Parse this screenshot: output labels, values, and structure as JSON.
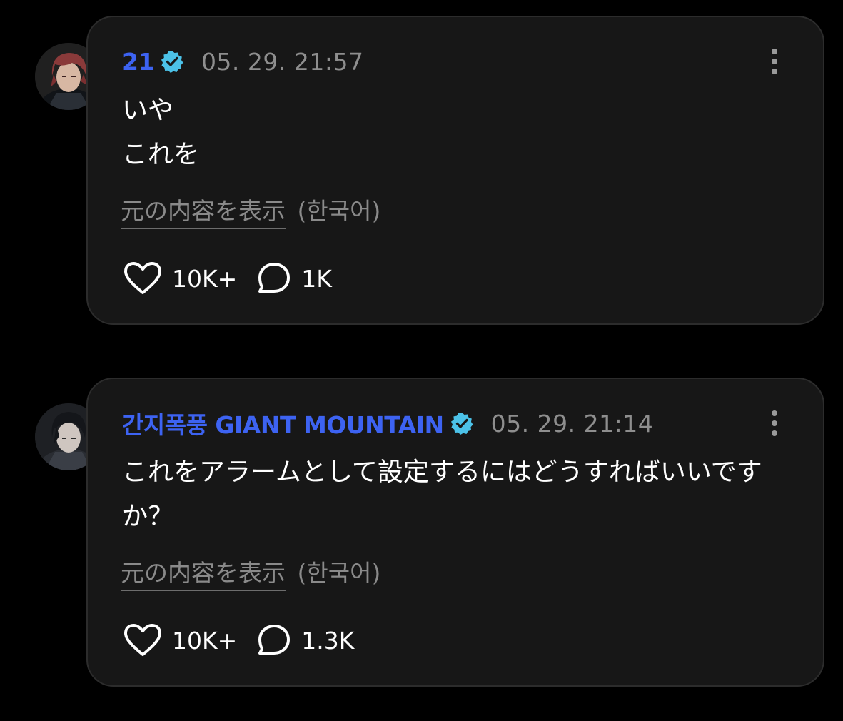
{
  "colors": {
    "background": "#000000",
    "card": "#171717",
    "username": "#3d63f2",
    "verified_badge": "#4cc2e8",
    "muted_text": "#8e8e8e"
  },
  "posts": [
    {
      "username": "21",
      "verified": true,
      "timestamp": "05. 29. 21:57",
      "text": "いや\nこれを",
      "translate_link": "元の内容を表示",
      "translate_lang": "(한국어)",
      "likes": "10K+",
      "comments": "1K",
      "icons": [
        "heart-icon",
        "comment-bubble-icon",
        "more-vertical-icon",
        "verified-badge-icon"
      ]
    },
    {
      "username": "간지폭풍 GIANT MOUNTAIN",
      "verified": true,
      "timestamp": "05. 29. 21:14",
      "text": "これをアラームとして設定するにはどうすればいいですか？",
      "translate_link": "元の内容を表示",
      "translate_lang": "(한국어)",
      "likes": "10K+",
      "comments": "1.3K",
      "icons": [
        "heart-icon",
        "comment-bubble-icon",
        "more-vertical-icon",
        "verified-badge-icon"
      ]
    }
  ]
}
